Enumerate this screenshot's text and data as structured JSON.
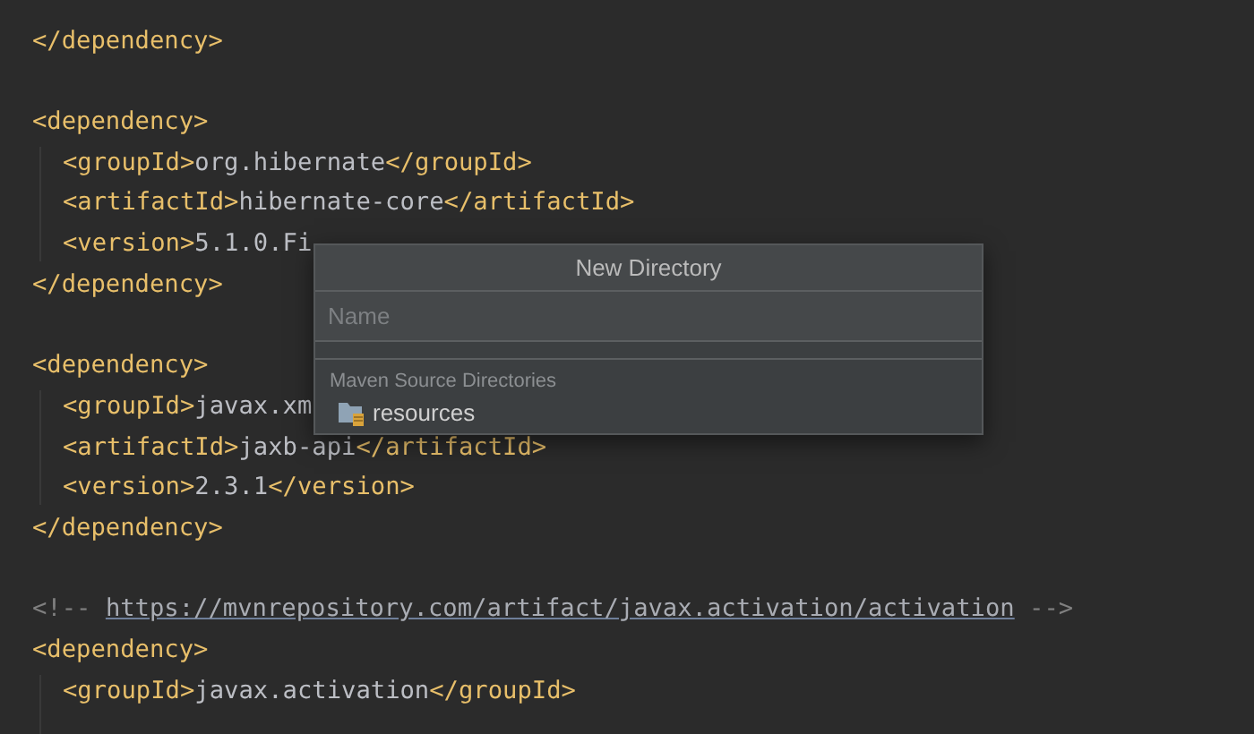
{
  "editor": {
    "lines": [
      {
        "kind": "code",
        "segments": [
          {
            "kind": "tag",
            "text": "</dependency>"
          }
        ]
      },
      {
        "kind": "blank"
      },
      {
        "kind": "code",
        "segments": [
          {
            "kind": "tag",
            "text": "<dependency>"
          }
        ],
        "children": [
          {
            "kind": "code",
            "segments": [
              {
                "kind": "tag",
                "text": "<groupId>"
              },
              {
                "kind": "text",
                "text": "org.hibernate"
              },
              {
                "kind": "tag",
                "text": "</groupId>"
              }
            ]
          },
          {
            "kind": "code",
            "segments": [
              {
                "kind": "tag",
                "text": "<artifactId>"
              },
              {
                "kind": "text",
                "text": "hibernate-core"
              },
              {
                "kind": "tag",
                "text": "</artifactId>"
              }
            ]
          },
          {
            "kind": "code",
            "segments": [
              {
                "kind": "tag",
                "text": "<version>"
              },
              {
                "kind": "text",
                "text": "5.1.0.Fi"
              }
            ]
          }
        ]
      },
      {
        "kind": "code",
        "segments": [
          {
            "kind": "tag",
            "text": "</dependency>"
          }
        ]
      },
      {
        "kind": "blank"
      },
      {
        "kind": "code",
        "segments": [
          {
            "kind": "tag",
            "text": "<dependency>"
          }
        ],
        "children": [
          {
            "kind": "code",
            "segments": [
              {
                "kind": "tag",
                "text": "<groupId>"
              },
              {
                "kind": "text",
                "text": "javax.xm"
              }
            ]
          },
          {
            "kind": "code",
            "segments": [
              {
                "kind": "tag",
                "text": "<artifactId>"
              },
              {
                "kind": "text",
                "text": "jaxb-api"
              },
              {
                "kind": "tag",
                "text": "</artifactId>"
              }
            ]
          },
          {
            "kind": "code",
            "segments": [
              {
                "kind": "tag",
                "text": "<version>"
              },
              {
                "kind": "text",
                "text": "2.3.1"
              },
              {
                "kind": "tag",
                "text": "</version>"
              }
            ]
          }
        ]
      },
      {
        "kind": "code",
        "segments": [
          {
            "kind": "tag",
            "text": "</dependency>"
          }
        ]
      },
      {
        "kind": "blank"
      },
      {
        "kind": "code",
        "segments": [
          {
            "kind": "comment",
            "text": "<!--"
          },
          {
            "kind": "link",
            "text": "https://mvnrepository.com/artifact/javax.activation/activation"
          },
          {
            "kind": "comment",
            "text": "-->"
          }
        ]
      },
      {
        "kind": "code",
        "segments": [
          {
            "kind": "tag",
            "text": "<dependency>"
          }
        ],
        "children": [
          {
            "kind": "code",
            "segments": [
              {
                "kind": "tag",
                "text": "<groupId>"
              },
              {
                "kind": "text",
                "text": "javax.activation"
              },
              {
                "kind": "tag",
                "text": "</groupId>"
              }
            ]
          }
        ]
      }
    ]
  },
  "popup": {
    "title": "New Directory",
    "name_field": {
      "placeholder": "Name"
    },
    "section": "Maven Source Directories",
    "items": [
      {
        "label": "resources",
        "selected": false
      }
    ]
  }
}
